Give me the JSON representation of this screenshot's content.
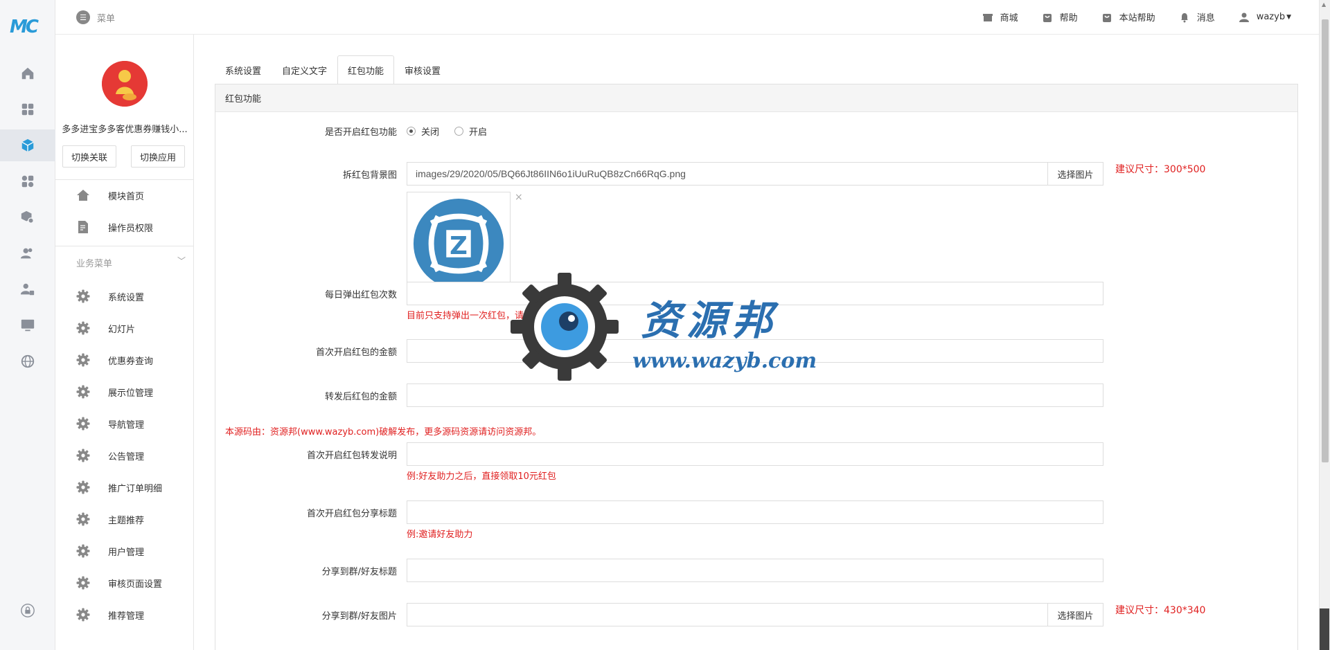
{
  "rail": {
    "logo": "MC",
    "icons": [
      "home-icon",
      "dashboard-icon",
      "module-cube-icon",
      "apps-icon",
      "package-settings-icon",
      "users-icon",
      "user-lock-icon",
      "monitor-icon",
      "globe-icon",
      "lock-icon"
    ]
  },
  "topbar": {
    "menu_label": "菜单",
    "nav": [
      {
        "label": "商城",
        "icon": "shop-icon"
      },
      {
        "label": "帮助",
        "icon": "help-bag-icon"
      },
      {
        "label": "本站帮助",
        "icon": "site-help-icon"
      },
      {
        "label": "消息",
        "icon": "bell-icon"
      },
      {
        "label": "wazyb",
        "icon": "user-icon"
      }
    ]
  },
  "sidebar": {
    "app_name": "多多进宝多多客优惠券赚钱小...",
    "switch_link_btn": "切换关联",
    "switch_app_btn": "切换应用",
    "top_items": [
      {
        "label": "模块首页",
        "icon": "home-icon"
      },
      {
        "label": "操作员权限",
        "icon": "document-edit-icon"
      }
    ],
    "group_title": "业务菜单",
    "group_items": [
      {
        "label": "系统设置"
      },
      {
        "label": "幻灯片"
      },
      {
        "label": "优惠券查询"
      },
      {
        "label": "展示位管理"
      },
      {
        "label": "导航管理"
      },
      {
        "label": "公告管理"
      },
      {
        "label": "推广订单明细"
      },
      {
        "label": "主题推荐"
      },
      {
        "label": "用户管理"
      },
      {
        "label": "审核页面设置"
      },
      {
        "label": "推荐管理"
      }
    ]
  },
  "main": {
    "tabs": [
      "系统设置",
      "自定义文字",
      "红包功能",
      "审核设置"
    ],
    "active_tab": "红包功能",
    "panel_title": "红包功能",
    "form": {
      "enable": {
        "label": "是否开启红包功能",
        "options": [
          "关闭",
          "开启"
        ],
        "selected": "关闭"
      },
      "bg": {
        "label": "拆红包背景图",
        "value": "images/29/2020/05/BQ66Jt86IIN6o1iUuRuQB8zCn66RqG.png",
        "btn": "选择图片",
        "size": "建议尺寸：300*500",
        "remove": "×"
      },
      "daily": {
        "label": "每日弹出红包次数",
        "value": "",
        "hint": "目前只支持弹出一次红包，请填写 1"
      },
      "first_amount": {
        "label": "首次开启红包的金额",
        "value": ""
      },
      "share_amount": {
        "label": "转发后红包的金额",
        "value": ""
      },
      "notice": "本源码由：资源邦(www.wazyb.com)破解发布，更多源码资源请访问资源邦。",
      "forward_desc": {
        "label": "首次开启红包转发说明",
        "value": "",
        "hint": "例:好友助力之后，直接领取10元红包"
      },
      "share_title": {
        "label": "首次开启红包分享标题",
        "value": "",
        "hint": "例:邀请好友助力"
      },
      "group_title": {
        "label": "分享到群/好友标题",
        "value": ""
      },
      "group_image": {
        "label": "分享到群/好友图片",
        "value": "",
        "btn": "选择图片",
        "size": "建议尺寸：430*340"
      }
    }
  },
  "watermark": {
    "title": "资源邦",
    "url": "www.wazyb.com"
  },
  "colors": {
    "accent_blue": "#2a9bd8",
    "error_red": "#e02020",
    "watermark_blue": "#2b6fb0"
  }
}
